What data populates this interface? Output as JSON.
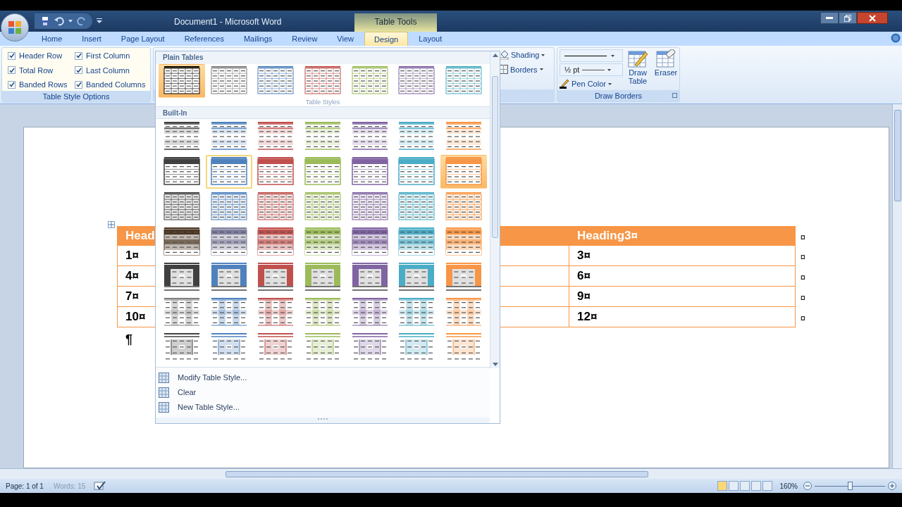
{
  "title_bar": {
    "title": "Document1 - Microsoft Word",
    "context_label": "Table Tools"
  },
  "tabs": [
    {
      "label": "Home",
      "selected": false
    },
    {
      "label": "Insert",
      "selected": false
    },
    {
      "label": "Page Layout",
      "selected": false
    },
    {
      "label": "References",
      "selected": false
    },
    {
      "label": "Mailings",
      "selected": false
    },
    {
      "label": "Review",
      "selected": false
    },
    {
      "label": "View",
      "selected": false
    },
    {
      "label": "Design",
      "selected": true
    },
    {
      "label": "Layout",
      "selected": false
    }
  ],
  "table_style_options": {
    "group_label": "Table Style Options",
    "options": [
      {
        "label": "Header Row",
        "checked": true
      },
      {
        "label": "Total Row",
        "checked": true
      },
      {
        "label": "Banded Rows",
        "checked": true
      },
      {
        "label": "First Column",
        "checked": true
      },
      {
        "label": "Last Column",
        "checked": true
      },
      {
        "label": "Banded Columns",
        "checked": true
      }
    ]
  },
  "table_styles_group": {
    "group_label": "Table Styles",
    "shading": "Shading",
    "borders": "Borders"
  },
  "draw_borders": {
    "group_label": "Draw Borders",
    "line_weight": "½ pt",
    "pen_color": "Pen Color",
    "draw_table": "Draw Table",
    "eraser": "Eraser"
  },
  "gallery": {
    "plain_header": "Plain Tables",
    "builtin_header": "Built-In",
    "plain": {
      "kind": "plain",
      "items": [
        {
          "color": "#000000",
          "selected": false,
          "hovered": true
        },
        {
          "color": "#7f7f7f",
          "selected": false,
          "hovered": false
        },
        {
          "color": "#4f81bd",
          "selected": false,
          "hovered": false
        },
        {
          "color": "#c0504d",
          "selected": false,
          "hovered": false
        },
        {
          "color": "#9bbb59",
          "selected": false,
          "hovered": false
        },
        {
          "color": "#8064a2",
          "selected": false,
          "hovered": false
        },
        {
          "color": "#4bacc6",
          "selected": false,
          "hovered": false
        }
      ]
    },
    "rows": [
      {
        "kind": "lines",
        "items": [
          {
            "color": "#404040",
            "selected": false,
            "hovered": false
          },
          {
            "color": "#4f81bd",
            "selected": false,
            "hovered": false
          },
          {
            "color": "#c0504d",
            "selected": false,
            "hovered": false
          },
          {
            "color": "#9bbb59",
            "selected": false,
            "hovered": false
          },
          {
            "color": "#8064a2",
            "selected": false,
            "hovered": false
          },
          {
            "color": "#4bacc6",
            "selected": false,
            "hovered": false
          },
          {
            "color": "#f79646",
            "selected": false,
            "hovered": false
          }
        ]
      },
      {
        "kind": "header",
        "items": [
          {
            "color": "#404040",
            "selected": false,
            "hovered": false
          },
          {
            "color": "#4f81bd",
            "selected": true,
            "hovered": false
          },
          {
            "color": "#c0504d",
            "selected": false,
            "hovered": false
          },
          {
            "color": "#9bbb59",
            "selected": false,
            "hovered": false
          },
          {
            "color": "#8064a2",
            "selected": false,
            "hovered": false
          },
          {
            "color": "#4bacc6",
            "selected": false,
            "hovered": false
          },
          {
            "color": "#f79646",
            "selected": false,
            "hovered": true
          }
        ]
      },
      {
        "kind": "grid",
        "items": [
          {
            "color": "#404040",
            "selected": false,
            "hovered": false
          },
          {
            "color": "#4f81bd",
            "selected": false,
            "hovered": false
          },
          {
            "color": "#c0504d",
            "selected": false,
            "hovered": false
          },
          {
            "color": "#9bbb59",
            "selected": false,
            "hovered": false
          },
          {
            "color": "#8064a2",
            "selected": false,
            "hovered": false
          },
          {
            "color": "#4bacc6",
            "selected": false,
            "hovered": false
          },
          {
            "color": "#f79646",
            "selected": false,
            "hovered": false
          }
        ]
      },
      {
        "kind": "banded",
        "items": [
          {
            "color": "#4a3520",
            "selected": false,
            "hovered": false
          },
          {
            "color": "#7f7f9f",
            "selected": false,
            "hovered": false
          },
          {
            "color": "#c0504d",
            "selected": false,
            "hovered": false
          },
          {
            "color": "#9bbb59",
            "selected": false,
            "hovered": false
          },
          {
            "color": "#8064a2",
            "selected": false,
            "hovered": false
          },
          {
            "color": "#4bacc6",
            "selected": false,
            "hovered": false
          },
          {
            "color": "#f79646",
            "selected": false,
            "hovered": false
          }
        ]
      },
      {
        "kind": "framed",
        "items": [
          {
            "color": "#404040",
            "selected": false,
            "hovered": false
          },
          {
            "color": "#4f81bd",
            "selected": false,
            "hovered": false
          },
          {
            "color": "#c0504d",
            "selected": false,
            "hovered": false
          },
          {
            "color": "#9bbb59",
            "selected": false,
            "hovered": false
          },
          {
            "color": "#8064a2",
            "selected": false,
            "hovered": false
          },
          {
            "color": "#4bacc6",
            "selected": false,
            "hovered": false
          },
          {
            "color": "#f79646",
            "selected": false,
            "hovered": false
          }
        ]
      },
      {
        "kind": "columns",
        "items": [
          {
            "color": "#7f7f7f",
            "selected": false,
            "hovered": false
          },
          {
            "color": "#4f81bd",
            "selected": false,
            "hovered": false
          },
          {
            "color": "#c0504d",
            "selected": false,
            "hovered": false
          },
          {
            "color": "#9bbb59",
            "selected": false,
            "hovered": false
          },
          {
            "color": "#8064a2",
            "selected": false,
            "hovered": false
          },
          {
            "color": "#4bacc6",
            "selected": false,
            "hovered": false
          },
          {
            "color": "#f79646",
            "selected": false,
            "hovered": false
          }
        ]
      },
      {
        "kind": "boxed",
        "items": [
          {
            "color": "#404040",
            "selected": false,
            "hovered": false
          },
          {
            "color": "#4f81bd",
            "selected": false,
            "hovered": false
          },
          {
            "color": "#c0504d",
            "selected": false,
            "hovered": false
          },
          {
            "color": "#9bbb59",
            "selected": false,
            "hovered": false
          },
          {
            "color": "#8064a2",
            "selected": false,
            "hovered": false
          },
          {
            "color": "#4bacc6",
            "selected": false,
            "hovered": false
          },
          {
            "color": "#f79646",
            "selected": false,
            "hovered": false
          }
        ]
      }
    ],
    "menu": [
      {
        "label": "Modify Table Style..."
      },
      {
        "label": "Clear"
      },
      {
        "label": "New Table Style..."
      }
    ]
  },
  "document": {
    "table": {
      "rows": [
        {
          "header": true,
          "cells": [
            "Head",
            "Heading3¤"
          ],
          "end_mark": "¤"
        },
        {
          "header": false,
          "cells": [
            "1¤",
            "3¤"
          ],
          "end_mark": "¤"
        },
        {
          "header": false,
          "cells": [
            "4¤",
            "6¤"
          ],
          "end_mark": "¤"
        },
        {
          "header": false,
          "cells": [
            "7¤",
            "9¤"
          ],
          "end_mark": "¤"
        },
        {
          "header": false,
          "cells": [
            "10¤",
            "12¤"
          ],
          "end_mark": "¤"
        }
      ]
    },
    "paragraph_mark": "¶"
  },
  "status_bar": {
    "page": "Page: 1 of 1",
    "words": "Words: 15",
    "zoom": "160%",
    "zoom_level": {
      "level": 0.5
    }
  }
}
